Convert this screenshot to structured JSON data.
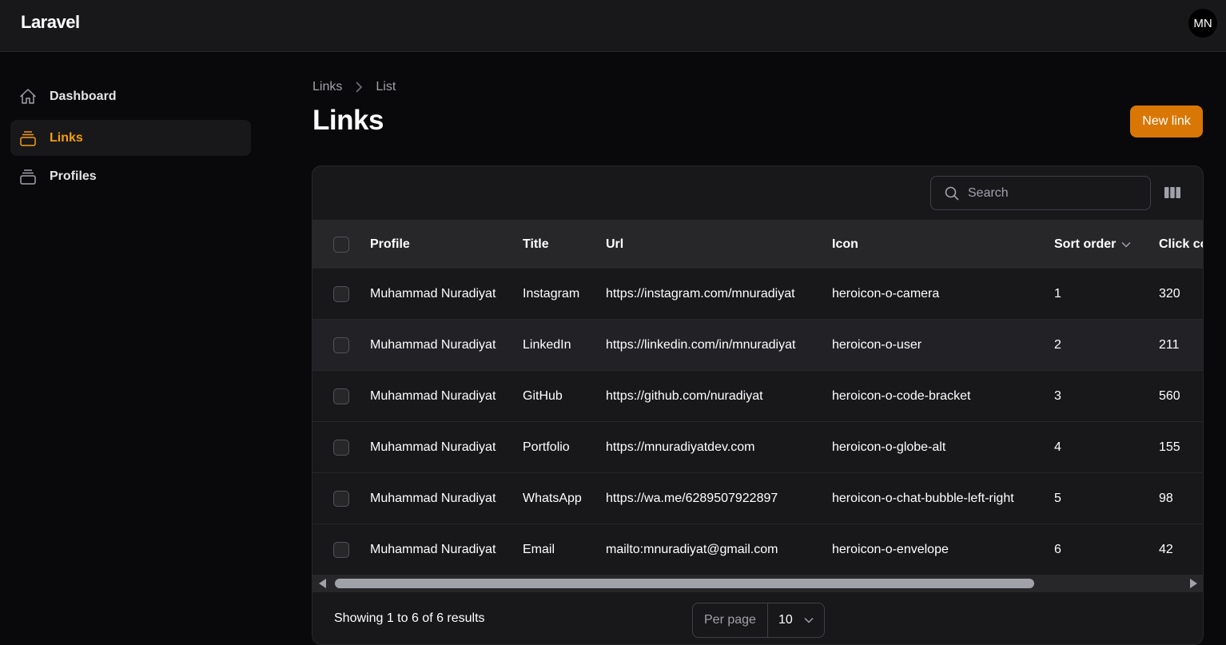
{
  "brand": "Laravel",
  "user": {
    "initials": "MN"
  },
  "sidebar": {
    "items": [
      {
        "label": "Dashboard",
        "icon": "home-icon",
        "active": false
      },
      {
        "label": "Links",
        "icon": "stack-icon",
        "active": true
      },
      {
        "label": "Profiles",
        "icon": "stack-icon",
        "active": false
      }
    ]
  },
  "breadcrumb": {
    "root": "Links",
    "current": "List"
  },
  "page": {
    "title": "Links",
    "new_button": "New link"
  },
  "search": {
    "placeholder": "Search",
    "value": ""
  },
  "table": {
    "columns": [
      "Profile",
      "Title",
      "Url",
      "Icon",
      "Sort order",
      "Click co"
    ],
    "rows": [
      {
        "profile": "Muhammad Nuradiyat",
        "title": "Instagram",
        "url": "https://instagram.com/mnuradiyat",
        "icon": "heroicon-o-camera",
        "sort": "1",
        "clicks": "320"
      },
      {
        "profile": "Muhammad Nuradiyat",
        "title": "LinkedIn",
        "url": "https://linkedin.com/in/mnuradiyat",
        "icon": "heroicon-o-user",
        "sort": "2",
        "clicks": "211"
      },
      {
        "profile": "Muhammad Nuradiyat",
        "title": "GitHub",
        "url": "https://github.com/nuradiyat",
        "icon": "heroicon-o-code-bracket",
        "sort": "3",
        "clicks": "560"
      },
      {
        "profile": "Muhammad Nuradiyat",
        "title": "Portfolio",
        "url": "https://mnuradiyatdev.com",
        "icon": "heroicon-o-globe-alt",
        "sort": "4",
        "clicks": "155"
      },
      {
        "profile": "Muhammad Nuradiyat",
        "title": "WhatsApp",
        "url": "https://wa.me/6289507922897",
        "icon": "heroicon-o-chat-bubble-left-right",
        "sort": "5",
        "clicks": "98"
      },
      {
        "profile": "Muhammad Nuradiyat",
        "title": "Email",
        "url": "mailto:mnuradiyat@gmail.com",
        "icon": "heroicon-o-envelope",
        "sort": "6",
        "clicks": "42"
      }
    ]
  },
  "footer": {
    "summary": "Showing 1 to 6 of 6 results",
    "per_page_label": "Per page",
    "per_page_value": "10"
  },
  "colors": {
    "accent": "#f59e0b",
    "button": "#d97706",
    "background": "#09090b",
    "panel": "#18181b"
  }
}
